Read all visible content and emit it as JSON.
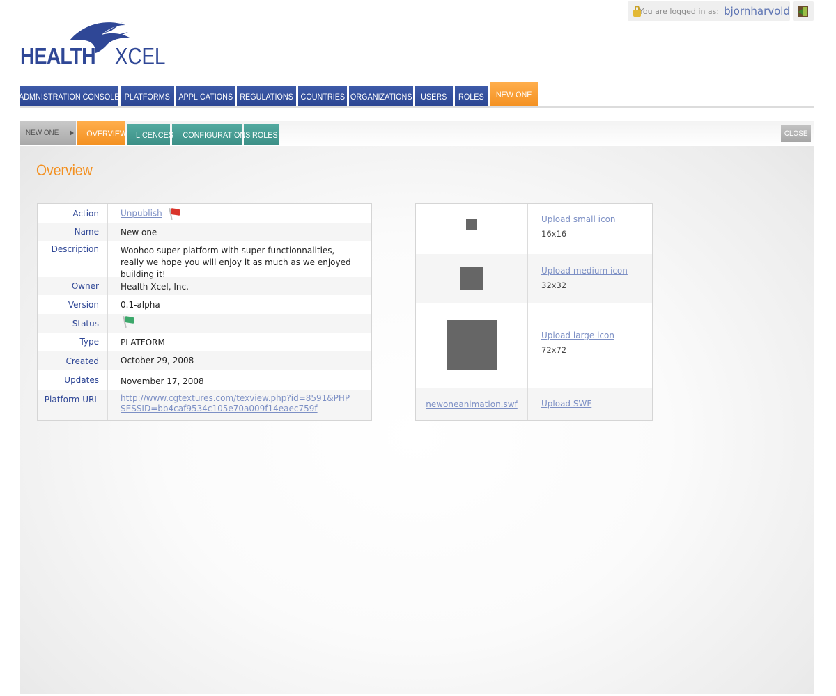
{
  "header": {
    "login_label": "You are logged in as:",
    "username": "bjornharvold",
    "logo": {
      "word1": "HEALTH",
      "word2": "XCEL"
    }
  },
  "main_nav": [
    {
      "label": "ADMNISTRATION CONSOLE",
      "active": false
    },
    {
      "label": "PLATFORMS",
      "active": false
    },
    {
      "label": "APPLICATIONS",
      "active": false
    },
    {
      "label": "REGULATIONS",
      "active": false
    },
    {
      "label": "COUNTRIES",
      "active": false
    },
    {
      "label": "ORGANIZATIONS",
      "active": false
    },
    {
      "label": "USERS",
      "active": false
    },
    {
      "label": "ROLES",
      "active": false
    },
    {
      "label": "NEW ONE",
      "active": true
    }
  ],
  "sub_nav": {
    "breadcrumb": "NEW ONE",
    "tabs": [
      {
        "label": "OVERVIEW",
        "active": true
      },
      {
        "label": "LICENCES",
        "active": false
      },
      {
        "label": "CONFIGURATIONS",
        "active": false
      },
      {
        "label": "ROLES",
        "active": false
      }
    ],
    "close_label": "CLOSE"
  },
  "page_title": "Overview",
  "details": {
    "action_label": "Action",
    "action_value": "Unpublish",
    "name_label": "Name",
    "name_value": "New one",
    "description_label": "Description",
    "description_value": "Woohoo super platform  with super functionnalities, really we hope you will enjoy it as much as we enjoyed building it!",
    "owner_label": "Owner",
    "owner_value": "Health Xcel, Inc.",
    "version_label": "Version",
    "version_value": "0.1-alpha",
    "status_label": "Status",
    "type_label": "Type",
    "type_value": "PLATFORM",
    "created_label": "Created",
    "created_value": "October 29, 2008",
    "updates_label": "Updates",
    "updates_value": "November 17, 2008",
    "url_label": "Platform URL",
    "url_value": "http://www.cgtextures.com/texview.php?id=8591&PHPSESSID=bb4caf9534c105e70a009f14eaec759f"
  },
  "icons": {
    "small": {
      "upload_label": "Upload small icon",
      "size": "16x16"
    },
    "medium": {
      "upload_label": "Upload medium icon",
      "size": "32x32"
    },
    "large": {
      "upload_label": "Upload large icon",
      "size": "72x72"
    },
    "swf": {
      "file_name": "newoneanimation.swf",
      "upload_label": "Upload SWF"
    }
  },
  "colors": {
    "brand_blue": "#2f4796",
    "accent_orange": "#f39020",
    "teal_tab": "#46998f",
    "link": "#7d90c5"
  }
}
